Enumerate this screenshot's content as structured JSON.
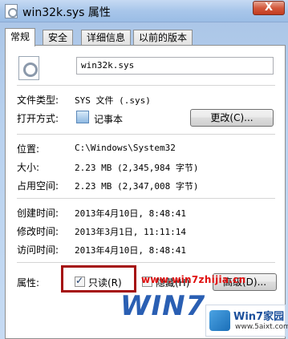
{
  "window": {
    "title": "win32k.sys 属性",
    "close_label": "X"
  },
  "tabs": [
    {
      "label": "常规",
      "active": true
    },
    {
      "label": "安全",
      "active": false
    },
    {
      "label": "详细信息",
      "active": false
    },
    {
      "label": "以前的版本",
      "active": false
    }
  ],
  "general": {
    "file_name": "win32k.sys",
    "file_type_label": "文件类型:",
    "file_type_value": "SYS 文件 (.sys)",
    "open_with_label": "打开方式:",
    "open_with_value": "记事本",
    "change_button": "更改(C)...",
    "location_label": "位置:",
    "location_value": "C:\\Windows\\System32",
    "size_label": "大小:",
    "size_value": "2.23 MB (2,345,984 字节)",
    "size_on_disk_label": "占用空间:",
    "size_on_disk_value": "2.23 MB (2,347,008 字节)",
    "created_label": "创建时间:",
    "created_value": "2013年4月10日, 8:48:41",
    "modified_label": "修改时间:",
    "modified_value": "2013年3月1日, 11:11:14",
    "accessed_label": "访问时间:",
    "accessed_value": "2013年4月10日, 8:48:41",
    "attributes_label": "属性:",
    "readonly_label": "只读(R)",
    "readonly_checked": true,
    "hidden_label": "隐藏(H)",
    "hidden_checked": false,
    "advanced_button": "高级(D)..."
  },
  "overlay": {
    "watermark": "www.win7zhijia.cn",
    "logo_text": "WIN7",
    "brand": "Win7家园",
    "site": "www.5aixt.com"
  },
  "colors": {
    "highlight_box": "#a50f0f",
    "watermark": "#e01010",
    "accent": "#2a5fb3"
  },
  "icons": {
    "window": "settings-file-icon",
    "file": "settings-file-icon",
    "open_with": "notepad-icon"
  }
}
